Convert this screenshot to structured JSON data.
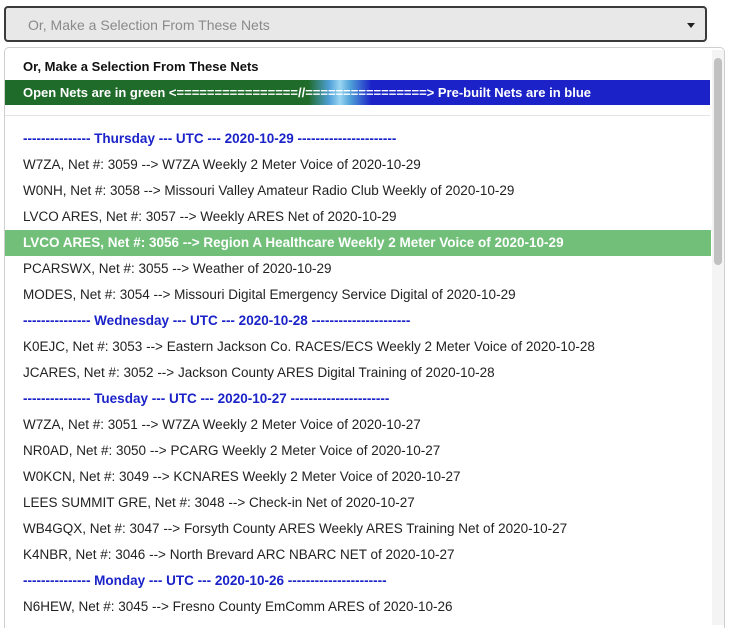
{
  "select": {
    "placeholder": "Or, Make a Selection From These Nets"
  },
  "dropdown": {
    "title": "Or, Make a Selection From These Nets",
    "legend_left": "Open Nets are in green <================//================> Pre-built Nets are in blue",
    "colors": {
      "open_green": "#1f6b2a",
      "prebuilt_blue": "#1a22c8",
      "selected_green": "#72bf7a",
      "header_blue": "#1a22c8"
    },
    "items": [
      {
        "kind": "header",
        "text": "--------------- Thursday --- UTC --- 2020-10-29 ----------------------"
      },
      {
        "kind": "net",
        "text": "W7ZA, Net #: 3059 --> W7ZA Weekly 2 Meter Voice of 2020-10-29"
      },
      {
        "kind": "net",
        "text": "W0NH, Net #: 3058 --> Missouri Valley Amateur Radio Club Weekly of 2020-10-29"
      },
      {
        "kind": "net",
        "text": "LVCO ARES, Net #: 3057 --> Weekly ARES Net of 2020-10-29"
      },
      {
        "kind": "selected",
        "text": "LVCO ARES, Net #: 3056 --> Region A Healthcare Weekly 2 Meter Voice of 2020-10-29"
      },
      {
        "kind": "net",
        "text": "PCARSWX, Net #: 3055 --> Weather of 2020-10-29"
      },
      {
        "kind": "net",
        "text": "MODES, Net #: 3054 --> Missouri Digital Emergency Service Digital of 2020-10-29"
      },
      {
        "kind": "header",
        "text": "--------------- Wednesday --- UTC --- 2020-10-28 ----------------------"
      },
      {
        "kind": "net",
        "text": "K0EJC, Net #: 3053 --> Eastern Jackson Co. RACES/ECS Weekly 2 Meter Voice of 2020-10-28"
      },
      {
        "kind": "net",
        "text": "JCARES, Net #: 3052 --> Jackson County ARES Digital Training of 2020-10-28"
      },
      {
        "kind": "header",
        "text": "--------------- Tuesday --- UTC --- 2020-10-27 ----------------------"
      },
      {
        "kind": "net",
        "text": "W7ZA, Net #: 3051 --> W7ZA Weekly 2 Meter Voice of 2020-10-27"
      },
      {
        "kind": "net",
        "text": "NR0AD, Net #: 3050 --> PCARG Weekly 2 Meter Voice of 2020-10-27"
      },
      {
        "kind": "net",
        "text": "W0KCN, Net #: 3049 --> KCNARES Weekly 2 Meter Voice of 2020-10-27"
      },
      {
        "kind": "net",
        "text": "LEES SUMMIT GRE, Net #: 3048 --> Check-in Net of 2020-10-27"
      },
      {
        "kind": "net",
        "text": "WB4GQX, Net #: 3047 --> Forsyth County ARES Weekly ARES Training Net of 2020-10-27"
      },
      {
        "kind": "net",
        "text": "K4NBR, Net #: 3046 --> North Brevard ARC NBARC NET of 2020-10-27"
      },
      {
        "kind": "header",
        "text": "--------------- Monday --- UTC --- 2020-10-26 ----------------------"
      },
      {
        "kind": "net",
        "text": "N6HEW, Net #: 3045 --> Fresno County EmComm ARES of 2020-10-26"
      }
    ]
  }
}
